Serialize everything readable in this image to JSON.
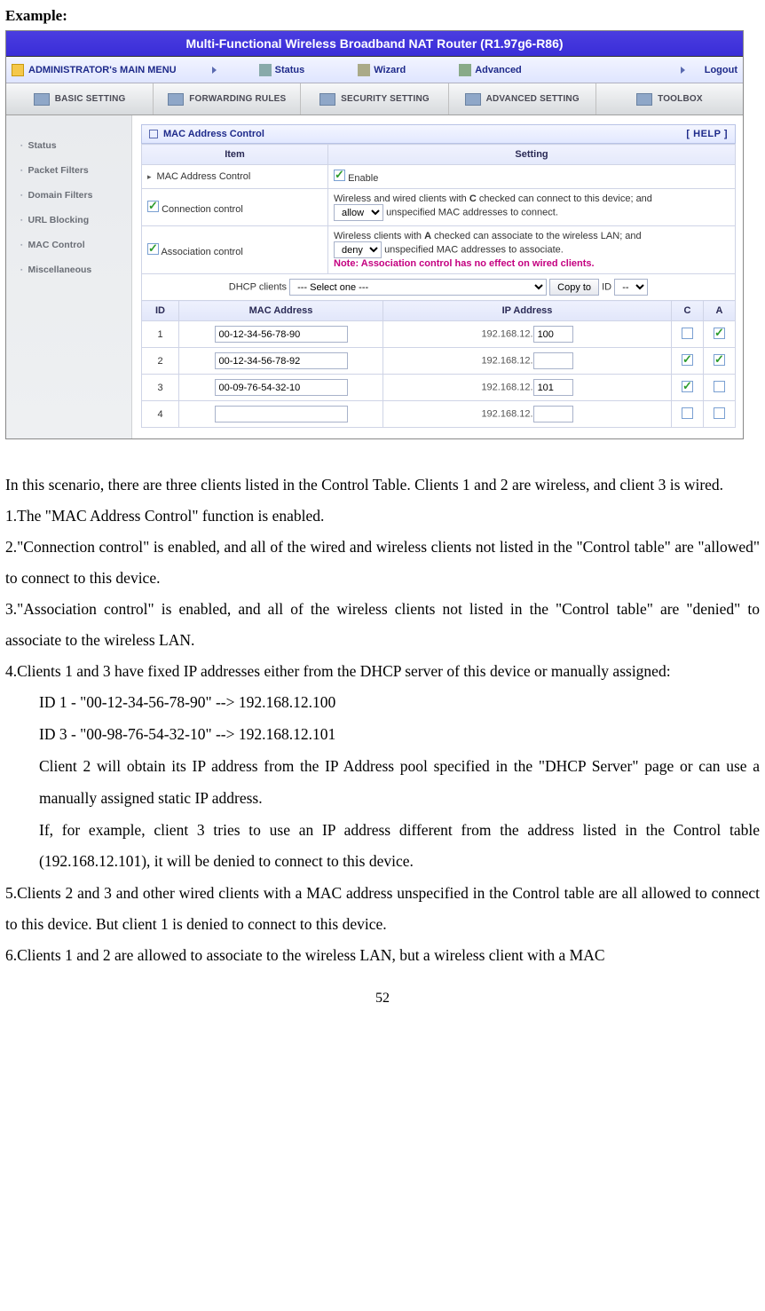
{
  "page": {
    "example_label": "Example:",
    "number": "52"
  },
  "router": {
    "title": "Multi-Functional Wireless Broadband NAT Router (R1.97g6-R86)",
    "menu": {
      "main_label": "ADMINISTRATOR's MAIN MENU",
      "status": "Status",
      "wizard": "Wizard",
      "advanced": "Advanced",
      "logout": "Logout"
    },
    "tabs": {
      "basic": "BASIC SETTING",
      "forwarding": "FORWARDING RULES",
      "security": "SECURITY SETTING",
      "advanced": "ADVANCED SETTING",
      "toolbox": "TOOLBOX"
    },
    "sidebar": {
      "items": [
        {
          "label": "Status"
        },
        {
          "label": "Packet Filters"
        },
        {
          "label": "Domain Filters"
        },
        {
          "label": "URL Blocking"
        },
        {
          "label": "MAC Control"
        },
        {
          "label": "Miscellaneous"
        }
      ]
    },
    "panel": {
      "title": "MAC Address Control",
      "help": "[ HELP ]",
      "col_item": "Item",
      "col_setting": "Setting",
      "mac_ctrl_row": "MAC Address Control",
      "enable_label": "Enable",
      "conn_ctrl": {
        "label": "Connection control",
        "text_before": "Wireless and wired clients with ",
        "text_bold1": "C",
        "text_mid": " checked can connect to this device; and ",
        "select": "allow",
        "text_after": " unspecified MAC addresses to connect."
      },
      "assoc_ctrl": {
        "label": "Association control",
        "text_before": "Wireless clients with ",
        "text_bold1": "A",
        "text_mid": " checked can associate to the wireless LAN; and ",
        "select": "deny",
        "text_after": " unspecified MAC addresses to associate.",
        "note": "Note: Association control has no effect on wired clients."
      },
      "dhcp": {
        "label": "DHCP clients",
        "select": "--- Select one ---",
        "copy_btn": "Copy to",
        "id_label": "ID",
        "id_select": "--"
      },
      "ctl_headers": {
        "id": "ID",
        "mac": "MAC Address",
        "ip": "IP Address",
        "c": "C",
        "a": "A"
      },
      "ip_prefix": "192.168.12.",
      "rows": [
        {
          "id": "1",
          "mac": "00-12-34-56-78-90",
          "ip": "100",
          "c": false,
          "a": true
        },
        {
          "id": "2",
          "mac": "00-12-34-56-78-92",
          "ip": "",
          "c": true,
          "a": true
        },
        {
          "id": "3",
          "mac": "00-09-76-54-32-10",
          "ip": "101",
          "c": true,
          "a": false
        },
        {
          "id": "4",
          "mac": "",
          "ip": "",
          "c": false,
          "a": false
        }
      ]
    }
  },
  "doc": {
    "p1": "In this scenario, there are three clients listed in the Control Table. Clients 1 and 2 are wireless, and client 3 is wired.",
    "l1": "1.The \"MAC Address Control\" function is enabled.",
    "l2": "2.\"Connection control\" is enabled, and all of the wired and wireless clients not listed in the \"Control table\" are \"allowed\" to connect to this device.",
    "l3": "3.\"Association control\" is enabled, and all of the wireless clients not listed in the \"Control table\" are \"denied\" to associate to the wireless LAN.",
    "l4": "4.Clients 1 and 3 have fixed IP addresses either from the DHCP server of this device or manually assigned:",
    "l4a": "ID 1 - \"00-12-34-56-78-90\" --> 192.168.12.100",
    "l4b": "ID 3 - \"00-98-76-54-32-10\" --> 192.168.12.101",
    "l4c": "Client 2 will obtain its IP address from the IP Address pool specified in the \"DHCP Server\" page or can use a manually assigned static IP address.",
    "l4d": "If, for example, client 3 tries to use an IP address different from the address listed in the Control table (192.168.12.101), it will be denied to connect to this device.",
    "l5": "5.Clients 2 and 3 and other wired clients with a MAC address unspecified in the Control table are all allowed to connect to this device. But client 1 is denied to connect to this device.",
    "l6": "6.Clients 1 and 2 are allowed to associate to the wireless LAN, but a wireless client with a MAC"
  }
}
